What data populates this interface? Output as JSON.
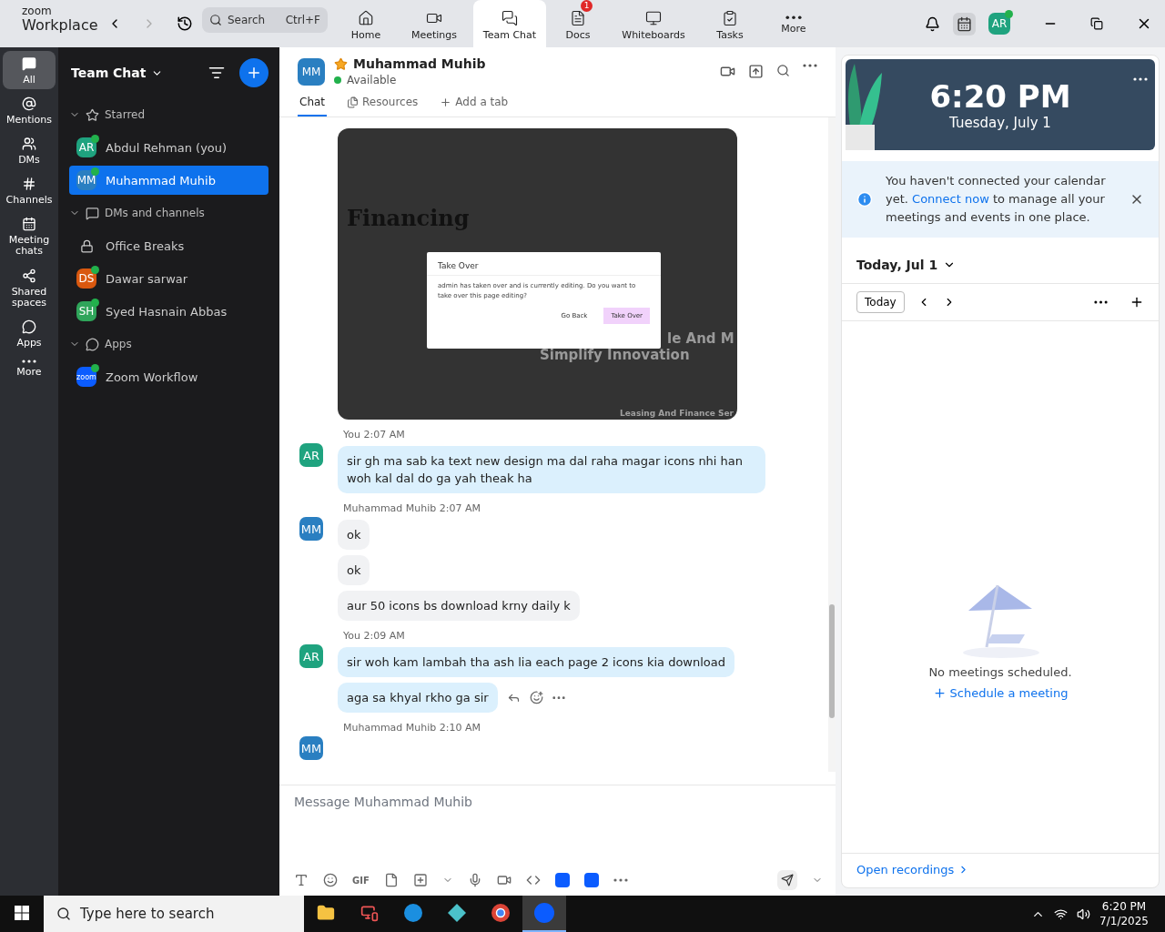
{
  "app": {
    "brand_top": "zoom",
    "brand": "Workplace",
    "search": {
      "placeholder": "Search",
      "shortcut": "Ctrl+F"
    }
  },
  "nav_tabs": [
    {
      "label": "Home",
      "kind": "home",
      "selected": false
    },
    {
      "label": "Meetings",
      "kind": "video",
      "selected": false
    },
    {
      "label": "Team Chat",
      "kind": "chat",
      "selected": true
    },
    {
      "label": "Docs",
      "kind": "doc",
      "selected": false,
      "badge": "1"
    },
    {
      "label": "Whiteboards",
      "kind": "board",
      "selected": false
    },
    {
      "label": "Tasks",
      "kind": "tasks",
      "selected": false
    },
    {
      "label": "More",
      "kind": "more",
      "selected": false
    }
  ],
  "user": {
    "initials": "AR",
    "online": true
  },
  "rail": [
    {
      "label": "All",
      "kind": "all",
      "selected": true
    },
    {
      "label": "Mentions",
      "kind": "mention",
      "selected": false
    },
    {
      "label": "DMs",
      "kind": "dms",
      "selected": false
    },
    {
      "label": "Channels",
      "kind": "hash",
      "selected": false
    },
    {
      "label": "Meeting chats",
      "kind": "calendar",
      "selected": false
    },
    {
      "label": "Shared spaces",
      "kind": "share",
      "selected": false
    },
    {
      "label": "Apps",
      "kind": "apps",
      "selected": false
    },
    {
      "label": "More",
      "kind": "more",
      "selected": false
    }
  ],
  "sidebar": {
    "title": "Team Chat",
    "sections": [
      {
        "label": "Starred",
        "kind": "star",
        "expanded": true,
        "items": [
          {
            "name": "Abdul Rehman (you)",
            "initials": "AR",
            "color": "#1fa37f",
            "online": true,
            "selected": false
          },
          {
            "name": "Muhammad Muhib",
            "initials": "MM",
            "color": "#2a7fc1",
            "online": true,
            "selected": true
          }
        ]
      },
      {
        "label": "DMs and channels",
        "kind": "chat",
        "expanded": true,
        "items": [
          {
            "name": "Office Breaks",
            "kind": "channel",
            "selected": false
          },
          {
            "name": "Dawar sarwar",
            "initials": "DS",
            "color": "#d9580f",
            "online": true,
            "selected": false
          },
          {
            "name": "Syed Hasnain Abbas",
            "initials": "SH",
            "color": "#2fa55a",
            "online": true,
            "selected": false
          }
        ]
      },
      {
        "label": "Apps",
        "kind": "apps",
        "expanded": true,
        "items": [
          {
            "name": "Zoom Workflow",
            "initials": "zoom",
            "color": "#0b5cff",
            "online": true,
            "selected": false
          }
        ]
      }
    ]
  },
  "chat": {
    "contact": {
      "name": "Muhammad Muhib",
      "initials": "MM",
      "status": "Available",
      "starred": true
    },
    "tabs": [
      {
        "label": "Chat",
        "kind": "chat",
        "selected": true
      },
      {
        "label": "Resources",
        "kind": "files",
        "selected": false
      },
      {
        "label": "Add a tab",
        "kind": "add",
        "selected": false
      }
    ],
    "image_message": {
      "heading": "Financing",
      "partial_title": "le And M",
      "subtitle": "Simplify Innovation",
      "footer": "Leasing And Finance Ser",
      "dialog": {
        "title": "Take Over",
        "body": "admin has taken over and is currently editing. Do you want to take over this page editing?",
        "buttons": [
          "Go Back",
          "Take Over"
        ]
      }
    },
    "groups": [
      {
        "sender": "You",
        "time": "2:07 AM",
        "initials": "AR",
        "mine": true,
        "messages": [
          "sir gh ma sab ka text new design ma dal raha magar icons nhi han woh kal dal do ga yah theak ha"
        ]
      },
      {
        "sender": "Muhammad Muhib",
        "time": "2:07 AM",
        "initials": "MM",
        "mine": false,
        "messages": [
          "ok",
          "ok",
          "aur 50 icons bs download krny daily k"
        ]
      },
      {
        "sender": "You",
        "time": "2:09 AM",
        "initials": "AR",
        "mine": true,
        "messages": [
          "sir woh kam lambah tha ash lia each page 2 icons kia download",
          "aga sa khyal rkho ga sir"
        ]
      },
      {
        "sender": "Muhammad Muhib",
        "time": "2:10 AM",
        "initials": "MM",
        "mine": false
      }
    ],
    "composer": {
      "placeholder": "Message Muhammad Muhib",
      "gif": "GIF"
    }
  },
  "calendar": {
    "time": "6:20 PM",
    "date": "Tuesday, July 1",
    "notice": {
      "before": "You haven't connected your calendar yet.",
      "link": "Connect now",
      "after": "to manage all your meetings and events in one place."
    },
    "day": "Today, Jul 1",
    "today_button": "Today",
    "empty": "No meetings scheduled.",
    "schedule": "Schedule a meeting",
    "recordings": "Open recordings"
  },
  "taskbar": {
    "search_placeholder": "Type here to search",
    "time": "6:20 PM",
    "date": "7/1/2025"
  }
}
